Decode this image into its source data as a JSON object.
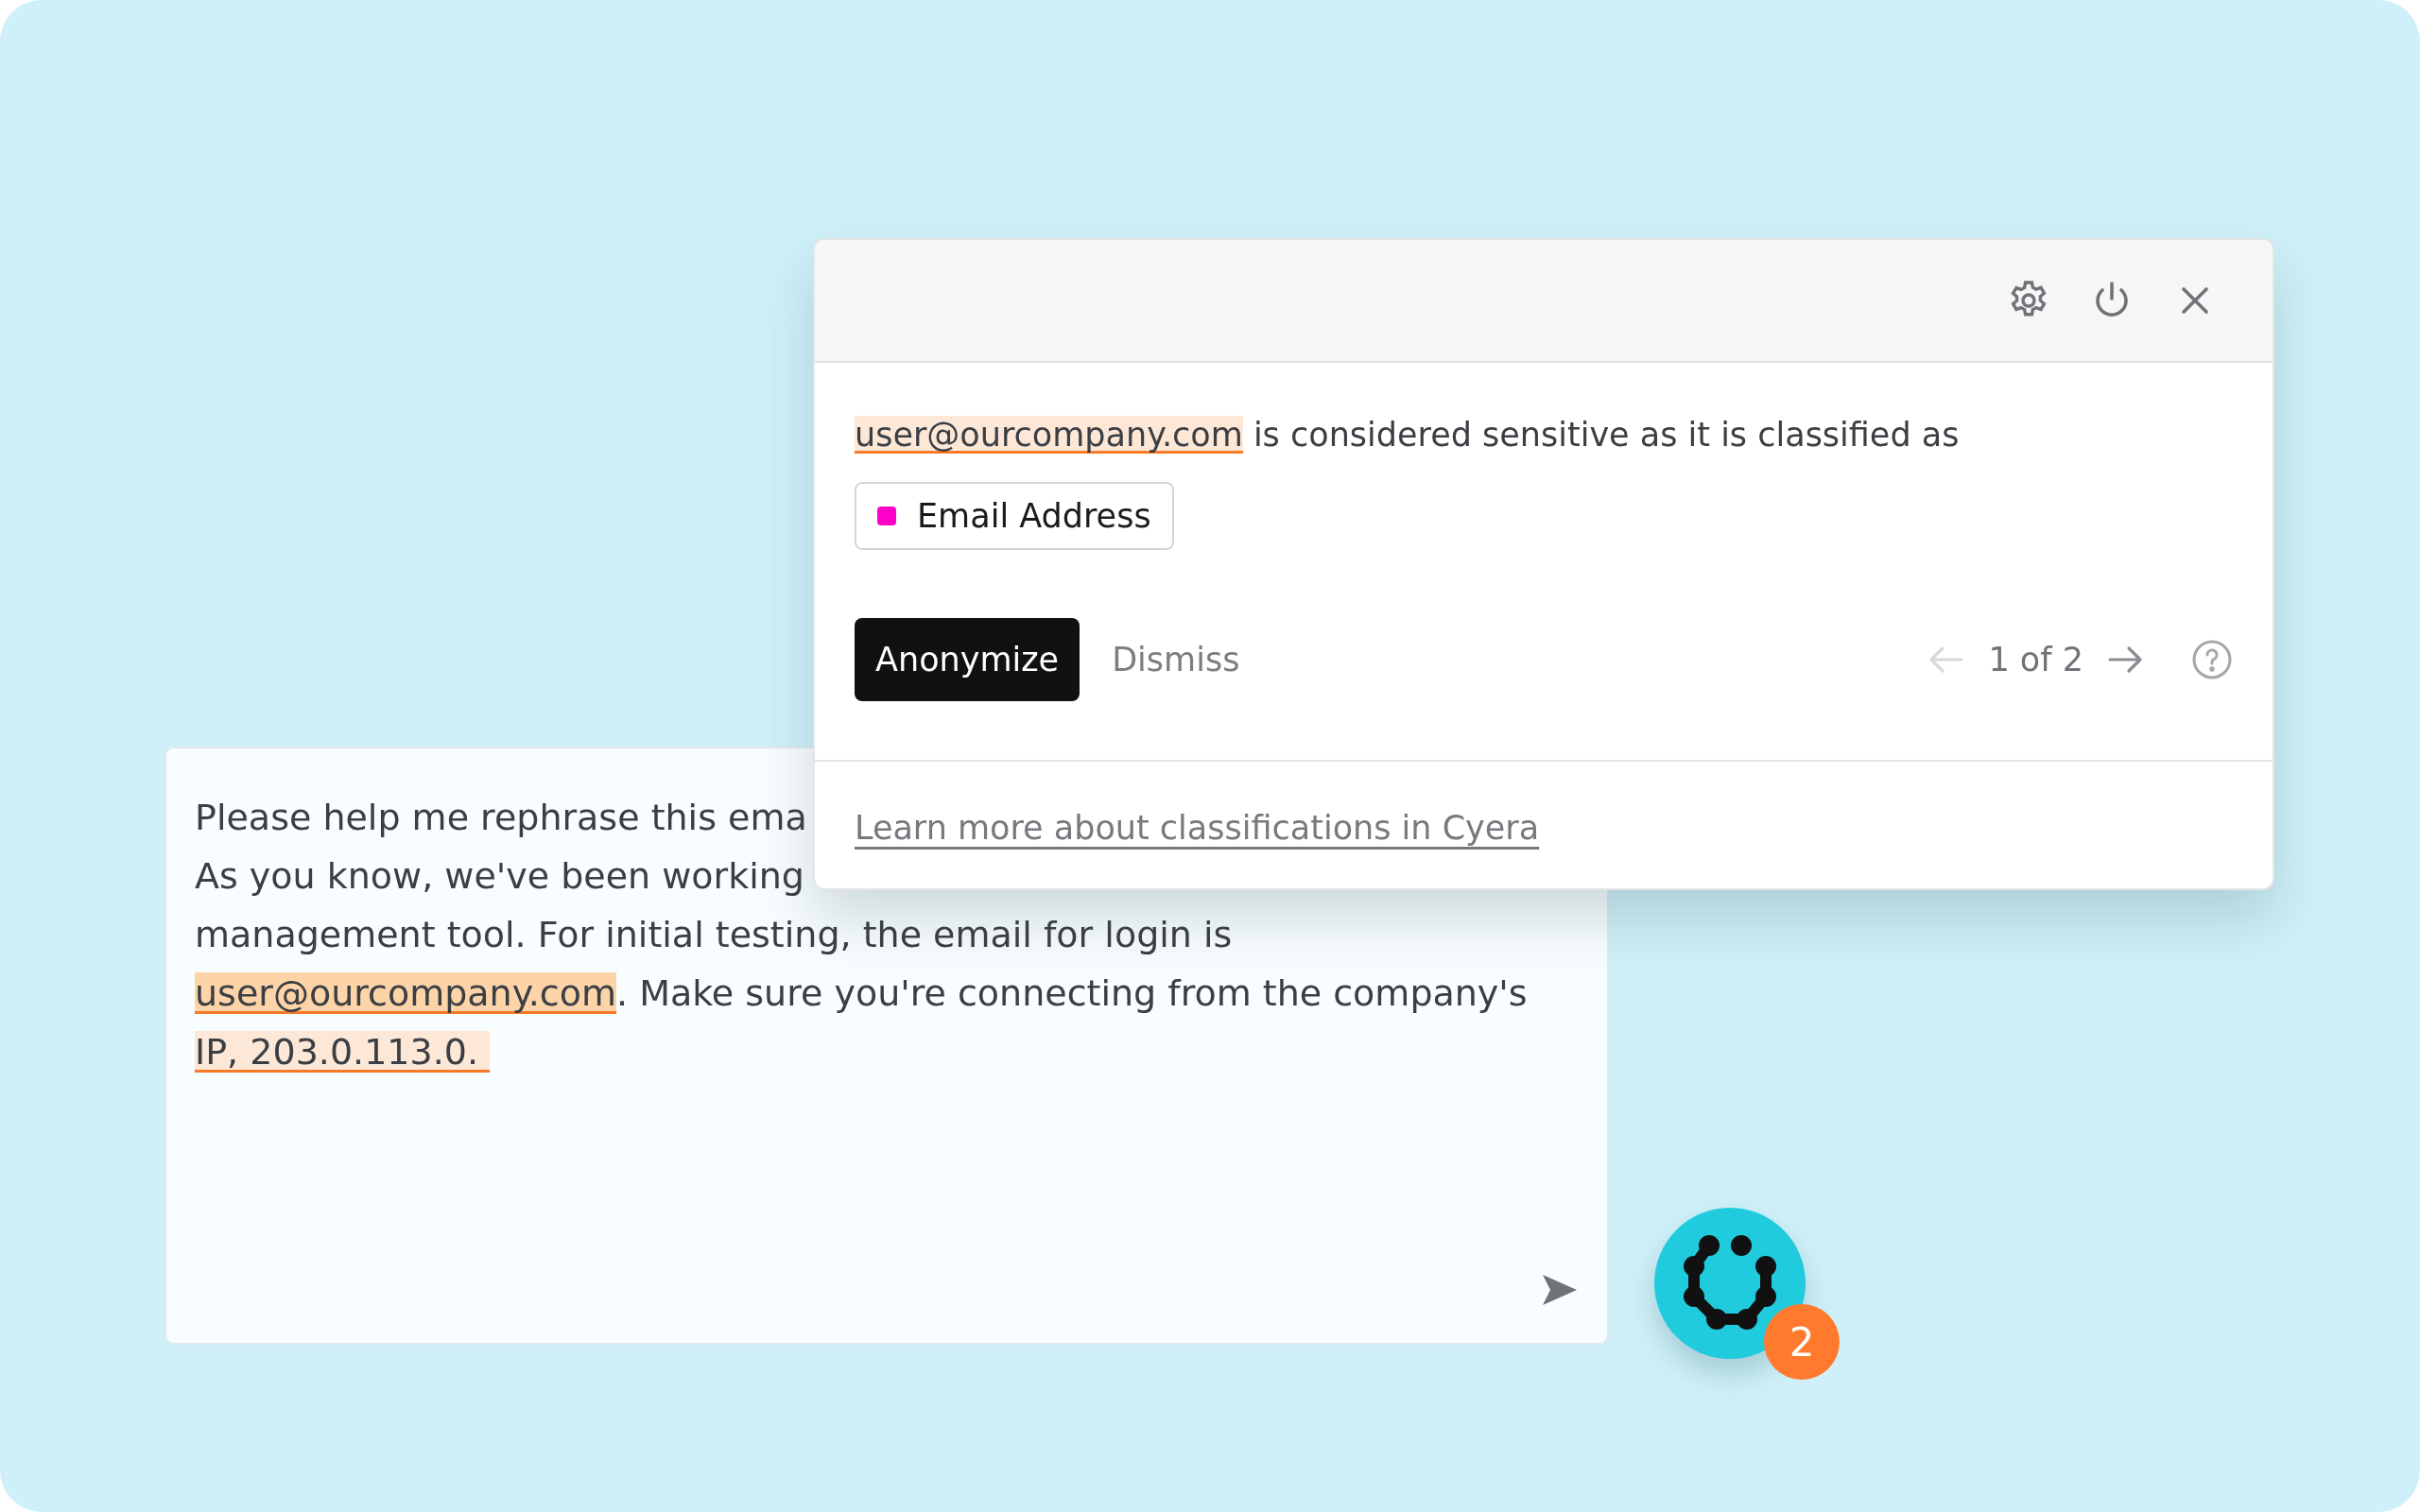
{
  "chat": {
    "lines": [
      {
        "segments": [
          {
            "text": "Please help me rephrase this ema",
            "highlighted": false,
            "selected": false
          }
        ]
      },
      {
        "segments": [
          {
            "text": "As you know, we've been working",
            "highlighted": false,
            "selected": false
          }
        ]
      },
      {
        "segments": [
          {
            "text": "management tool. For initial testing, the email for login is",
            "highlighted": false,
            "selected": false
          }
        ]
      },
      {
        "segments": [
          {
            "text": "user@ourcompany.com",
            "highlighted": true,
            "selected": true
          },
          {
            "text": ". Make sure you're connecting from the company's",
            "highlighted": false,
            "selected": false
          }
        ]
      },
      {
        "segments": [
          {
            "text": "IP, 203.0.113.0. ",
            "highlighted": true,
            "selected": false
          }
        ]
      }
    ]
  },
  "popup": {
    "message": [
      {
        "text": "user@ourcompany.com",
        "highlighted": true
      },
      {
        "text": " is considered sensitive as it is classified as",
        "highlighted": false
      }
    ],
    "tag": {
      "label": "Email Address",
      "color": "#ff00c8"
    },
    "buttons": [
      {
        "label": "Anonymize",
        "kind": "primary"
      },
      {
        "label": "Dismiss",
        "kind": "plain"
      }
    ],
    "pager": {
      "text": "1 of 2",
      "prev_disabled": true,
      "next_disabled": false
    },
    "link": "Learn more about classifications in Cyera"
  },
  "launcher": {
    "badge": "2"
  }
}
